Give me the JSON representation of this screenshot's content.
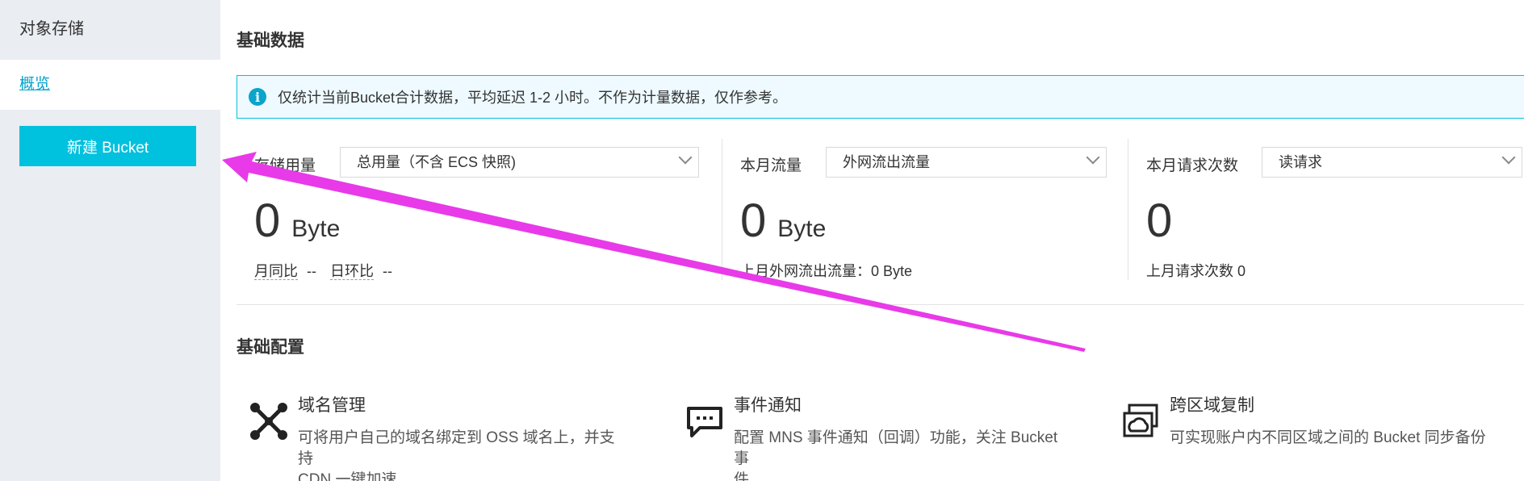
{
  "sidebar": {
    "title": "对象存储",
    "active_item": "概览",
    "new_bucket_label": "新建 Bucket"
  },
  "main": {
    "basic_data_title": "基础数据",
    "notice": "仅统计当前Bucket合计数据，平均延迟 1-2 小时。不作为计量数据，仅作参考。",
    "stats": [
      {
        "label": "存储用量",
        "select_value": "总用量（不含 ECS 快照)",
        "value": "0",
        "unit": "Byte",
        "sub_a_label": "月同比",
        "sub_a_value": "--",
        "sub_b_label": "日环比",
        "sub_b_value": "--"
      },
      {
        "label": "本月流量",
        "select_value": "外网流出流量",
        "value": "0",
        "unit": "Byte",
        "sub": "上月外网流出流量：0 Byte"
      },
      {
        "label": "本月请求次数",
        "select_value": "读请求",
        "value": "0",
        "sub": "上月请求次数  0"
      }
    ],
    "basic_config_title": "基础配置",
    "configs": [
      {
        "icon": "domain-nodes-icon",
        "title": "域名管理",
        "desc_line1": "可将用户自己的域名绑定到 OSS 域名上，并支持",
        "desc_line2": "CDN 一键加速"
      },
      {
        "icon": "event-notification-icon",
        "title": "事件通知",
        "desc_line1": "配置 MNS 事件通知（回调）功能，关注 Bucket 事",
        "desc_line2": "件"
      },
      {
        "icon": "cross-region-replication-icon",
        "title": "跨区域复制",
        "desc_line1": "可实现账户内不同区域之间的 Bucket 同步备份",
        "desc_line2": ""
      }
    ]
  },
  "colors": {
    "accent": "#00c1de",
    "link": "#00a2ca",
    "sidebar_bg": "#eaedf1",
    "annotation_arrow": "#e83ae8"
  }
}
